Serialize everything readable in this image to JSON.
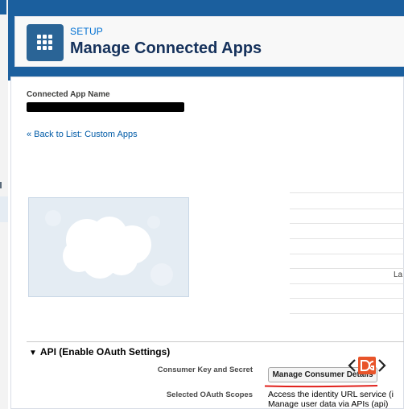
{
  "header": {
    "eyebrow": "SETUP",
    "title": "Manage Connected Apps",
    "icon": "app-grid-icon"
  },
  "detail": {
    "connected_app_name_label": "Connected App Name",
    "back_link": "« Back to List: Custom Apps"
  },
  "right_column": {
    "partial_label": "La"
  },
  "oauth_section": {
    "title": "API (Enable OAuth Settings)",
    "consumer_key_label": "Consumer Key and Secret",
    "manage_button_label": "Manage Consumer Details",
    "scopes_label": "Selected OAuth Scopes",
    "scopes": [
      "Access the identity URL service (i",
      "Manage user data via APIs (api)"
    ]
  },
  "colors": {
    "brand_blue": "#1b5f9e",
    "link": "#015ba7",
    "title": "#16325c",
    "annotation_red": "#e0201b"
  }
}
